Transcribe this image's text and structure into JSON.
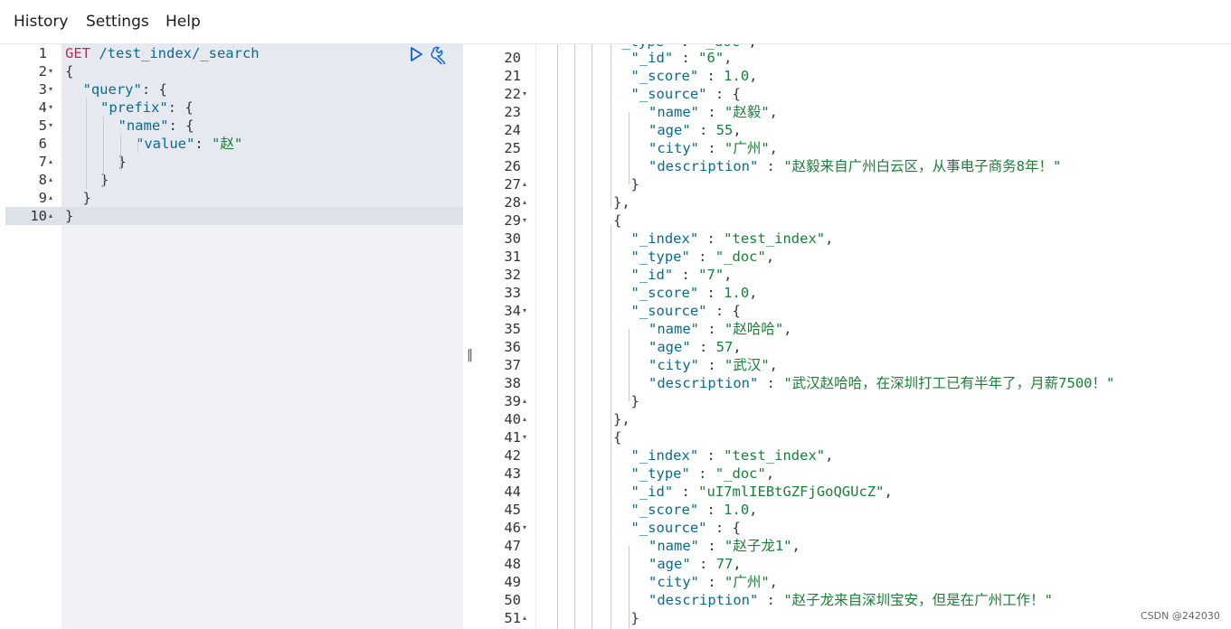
{
  "menu": [
    "History",
    "Settings",
    "Help"
  ],
  "request": {
    "lines": [
      {
        "n": "1",
        "fold": "",
        "indent": 0,
        "parts": [
          [
            "method",
            "GET"
          ],
          [
            "path",
            " /test_index/_search"
          ]
        ]
      },
      {
        "n": "2",
        "fold": "down",
        "indent": 0,
        "parts": [
          [
            "punct",
            "{"
          ]
        ]
      },
      {
        "n": "3",
        "fold": "down",
        "indent": 1,
        "parts": [
          [
            "key",
            "\"query\""
          ],
          [
            "punct",
            ": {"
          ]
        ]
      },
      {
        "n": "4",
        "fold": "down",
        "indent": 2,
        "parts": [
          [
            "key",
            "\"prefix\""
          ],
          [
            "punct",
            ": {"
          ]
        ]
      },
      {
        "n": "5",
        "fold": "down",
        "indent": 3,
        "parts": [
          [
            "key",
            "\"name\""
          ],
          [
            "punct",
            ": {"
          ]
        ]
      },
      {
        "n": "6",
        "fold": "",
        "indent": 4,
        "parts": [
          [
            "key",
            "\"value\""
          ],
          [
            "punct",
            ": "
          ],
          [
            "str",
            "\"赵\""
          ]
        ]
      },
      {
        "n": "7",
        "fold": "up",
        "indent": 3,
        "parts": [
          [
            "punct",
            "}"
          ]
        ]
      },
      {
        "n": "8",
        "fold": "up",
        "indent": 2,
        "parts": [
          [
            "punct",
            "}"
          ]
        ]
      },
      {
        "n": "9",
        "fold": "up",
        "indent": 1,
        "parts": [
          [
            "punct",
            "}"
          ]
        ]
      },
      {
        "n": "10",
        "fold": "up",
        "indent": 0,
        "parts": [
          [
            "punct",
            "}"
          ]
        ]
      }
    ]
  },
  "response": {
    "lines": [
      {
        "n": "20",
        "fold": "",
        "indent": 5,
        "parts": [
          [
            "key",
            "\"_id\""
          ],
          [
            "punct",
            " : "
          ],
          [
            "str",
            "\"6\""
          ],
          [
            "punct",
            ","
          ]
        ]
      },
      {
        "n": "21",
        "fold": "",
        "indent": 5,
        "parts": [
          [
            "key",
            "\"_score\""
          ],
          [
            "punct",
            " : "
          ],
          [
            "num",
            "1.0"
          ],
          [
            "punct",
            ","
          ]
        ]
      },
      {
        "n": "22",
        "fold": "down",
        "indent": 5,
        "parts": [
          [
            "key",
            "\"_source\""
          ],
          [
            "punct",
            " : {"
          ]
        ]
      },
      {
        "n": "23",
        "fold": "",
        "indent": 6,
        "parts": [
          [
            "key",
            "\"name\""
          ],
          [
            "punct",
            " : "
          ],
          [
            "str",
            "\"赵毅\""
          ],
          [
            "punct",
            ","
          ]
        ]
      },
      {
        "n": "24",
        "fold": "",
        "indent": 6,
        "parts": [
          [
            "key",
            "\"age\""
          ],
          [
            "punct",
            " : "
          ],
          [
            "num",
            "55"
          ],
          [
            "punct",
            ","
          ]
        ]
      },
      {
        "n": "25",
        "fold": "",
        "indent": 6,
        "parts": [
          [
            "key",
            "\"city\""
          ],
          [
            "punct",
            " : "
          ],
          [
            "str",
            "\"广州\""
          ],
          [
            "punct",
            ","
          ]
        ]
      },
      {
        "n": "26",
        "fold": "",
        "indent": 6,
        "parts": [
          [
            "key",
            "\"description\""
          ],
          [
            "punct",
            " : "
          ],
          [
            "str",
            "\"赵毅来自广州白云区，从事电子商务8年！\""
          ]
        ]
      },
      {
        "n": "27",
        "fold": "up",
        "indent": 5,
        "parts": [
          [
            "punct",
            "}"
          ]
        ]
      },
      {
        "n": "28",
        "fold": "up",
        "indent": 4,
        "parts": [
          [
            "punct",
            "},"
          ]
        ]
      },
      {
        "n": "29",
        "fold": "down",
        "indent": 4,
        "parts": [
          [
            "punct",
            "{"
          ]
        ]
      },
      {
        "n": "30",
        "fold": "",
        "indent": 5,
        "parts": [
          [
            "key",
            "\"_index\""
          ],
          [
            "punct",
            " : "
          ],
          [
            "str",
            "\"test_index\""
          ],
          [
            "punct",
            ","
          ]
        ]
      },
      {
        "n": "31",
        "fold": "",
        "indent": 5,
        "parts": [
          [
            "key",
            "\"_type\""
          ],
          [
            "punct",
            " : "
          ],
          [
            "str",
            "\"_doc\""
          ],
          [
            "punct",
            ","
          ]
        ]
      },
      {
        "n": "32",
        "fold": "",
        "indent": 5,
        "parts": [
          [
            "key",
            "\"_id\""
          ],
          [
            "punct",
            " : "
          ],
          [
            "str",
            "\"7\""
          ],
          [
            "punct",
            ","
          ]
        ]
      },
      {
        "n": "33",
        "fold": "",
        "indent": 5,
        "parts": [
          [
            "key",
            "\"_score\""
          ],
          [
            "punct",
            " : "
          ],
          [
            "num",
            "1.0"
          ],
          [
            "punct",
            ","
          ]
        ]
      },
      {
        "n": "34",
        "fold": "down",
        "indent": 5,
        "parts": [
          [
            "key",
            "\"_source\""
          ],
          [
            "punct",
            " : {"
          ]
        ]
      },
      {
        "n": "35",
        "fold": "",
        "indent": 6,
        "parts": [
          [
            "key",
            "\"name\""
          ],
          [
            "punct",
            " : "
          ],
          [
            "str",
            "\"赵哈哈\""
          ],
          [
            "punct",
            ","
          ]
        ]
      },
      {
        "n": "36",
        "fold": "",
        "indent": 6,
        "parts": [
          [
            "key",
            "\"age\""
          ],
          [
            "punct",
            " : "
          ],
          [
            "num",
            "57"
          ],
          [
            "punct",
            ","
          ]
        ]
      },
      {
        "n": "37",
        "fold": "",
        "indent": 6,
        "parts": [
          [
            "key",
            "\"city\""
          ],
          [
            "punct",
            " : "
          ],
          [
            "str",
            "\"武汉\""
          ],
          [
            "punct",
            ","
          ]
        ]
      },
      {
        "n": "38",
        "fold": "",
        "indent": 6,
        "parts": [
          [
            "key",
            "\"description\""
          ],
          [
            "punct",
            " : "
          ],
          [
            "str",
            "\"武汉赵哈哈，在深圳打工已有半年了，月薪7500！\""
          ]
        ]
      },
      {
        "n": "39",
        "fold": "up",
        "indent": 5,
        "parts": [
          [
            "punct",
            "}"
          ]
        ]
      },
      {
        "n": "40",
        "fold": "up",
        "indent": 4,
        "parts": [
          [
            "punct",
            "},"
          ]
        ]
      },
      {
        "n": "41",
        "fold": "down",
        "indent": 4,
        "parts": [
          [
            "punct",
            "{"
          ]
        ]
      },
      {
        "n": "42",
        "fold": "",
        "indent": 5,
        "parts": [
          [
            "key",
            "\"_index\""
          ],
          [
            "punct",
            " : "
          ],
          [
            "str",
            "\"test_index\""
          ],
          [
            "punct",
            ","
          ]
        ]
      },
      {
        "n": "43",
        "fold": "",
        "indent": 5,
        "parts": [
          [
            "key",
            "\"_type\""
          ],
          [
            "punct",
            " : "
          ],
          [
            "str",
            "\"_doc\""
          ],
          [
            "punct",
            ","
          ]
        ]
      },
      {
        "n": "44",
        "fold": "",
        "indent": 5,
        "parts": [
          [
            "key",
            "\"_id\""
          ],
          [
            "punct",
            " : "
          ],
          [
            "str",
            "\"uI7mlIEBtGZFjGoQGUcZ\""
          ],
          [
            "punct",
            ","
          ]
        ]
      },
      {
        "n": "45",
        "fold": "",
        "indent": 5,
        "parts": [
          [
            "key",
            "\"_score\""
          ],
          [
            "punct",
            " : "
          ],
          [
            "num",
            "1.0"
          ],
          [
            "punct",
            ","
          ]
        ]
      },
      {
        "n": "46",
        "fold": "down",
        "indent": 5,
        "parts": [
          [
            "key",
            "\"_source\""
          ],
          [
            "punct",
            " : {"
          ]
        ]
      },
      {
        "n": "47",
        "fold": "",
        "indent": 6,
        "parts": [
          [
            "key",
            "\"name\""
          ],
          [
            "punct",
            " : "
          ],
          [
            "str",
            "\"赵子龙1\""
          ],
          [
            "punct",
            ","
          ]
        ]
      },
      {
        "n": "48",
        "fold": "",
        "indent": 6,
        "parts": [
          [
            "key",
            "\"age\""
          ],
          [
            "punct",
            " : "
          ],
          [
            "num",
            "77"
          ],
          [
            "punct",
            ","
          ]
        ]
      },
      {
        "n": "49",
        "fold": "",
        "indent": 6,
        "parts": [
          [
            "key",
            "\"city\""
          ],
          [
            "punct",
            " : "
          ],
          [
            "str",
            "\"广州\""
          ],
          [
            "punct",
            ","
          ]
        ]
      },
      {
        "n": "50",
        "fold": "",
        "indent": 6,
        "parts": [
          [
            "key",
            "\"description\""
          ],
          [
            "punct",
            " : "
          ],
          [
            "str",
            "\"赵子龙来自深圳宝安，但是在广州工作！\""
          ]
        ]
      },
      {
        "n": "51",
        "fold": "up",
        "indent": 5,
        "parts": [
          [
            "punct",
            "}"
          ]
        ]
      }
    ]
  },
  "icons": {
    "run": "play-icon",
    "settings": "wrench-icon",
    "divider": "resize-handle-icon"
  },
  "watermark": "CSDN @242030"
}
